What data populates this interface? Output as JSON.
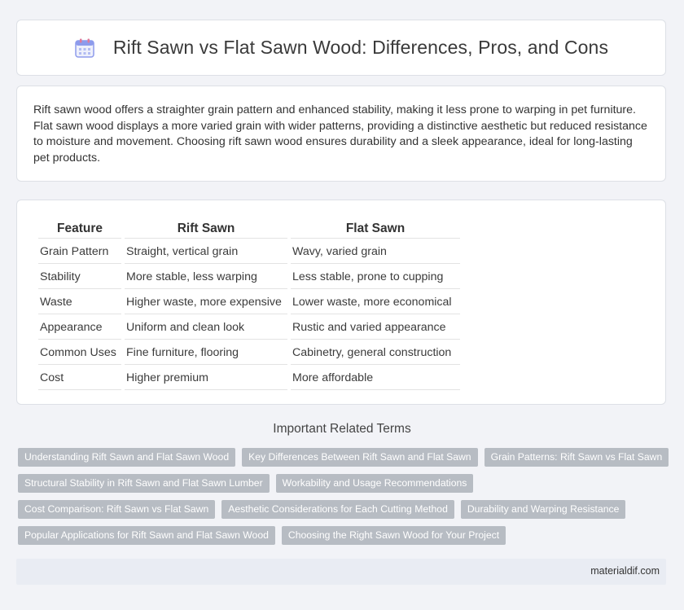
{
  "header": {
    "title": "Rift Sawn vs Flat Sawn Wood: Differences, Pros, and Cons",
    "icon": "calendar-icon"
  },
  "intro": {
    "text": "Rift sawn wood offers a straighter grain pattern and enhanced stability, making it less prone to warping in pet furniture. Flat sawn wood displays a more varied grain with wider patterns, providing a distinctive aesthetic but reduced resistance to moisture and movement. Choosing rift sawn wood ensures durability and a sleek appearance, ideal for long-lasting pet products."
  },
  "table": {
    "headers": [
      "Feature",
      "Rift Sawn",
      "Flat Sawn"
    ],
    "rows": [
      [
        "Grain Pattern",
        "Straight, vertical grain",
        "Wavy, varied grain"
      ],
      [
        "Stability",
        "More stable, less warping",
        "Less stable, prone to cupping"
      ],
      [
        "Waste",
        "Higher waste, more expensive",
        "Lower waste, more economical"
      ],
      [
        "Appearance",
        "Uniform and clean look",
        "Rustic and varied appearance"
      ],
      [
        "Common Uses",
        "Fine furniture, flooring",
        "Cabinetry, general construction"
      ],
      [
        "Cost",
        "Higher premium",
        "More affordable"
      ]
    ]
  },
  "related": {
    "title": "Important Related Terms",
    "tags": [
      "Understanding Rift Sawn and Flat Sawn Wood",
      "Key Differences Between Rift Sawn and Flat Sawn",
      "Grain Patterns: Rift Sawn vs Flat Sawn",
      "Structural Stability in Rift Sawn and Flat Sawn Lumber",
      "Workability and Usage Recommendations",
      "Cost Comparison: Rift Sawn vs Flat Sawn",
      "Aesthetic Considerations for Each Cutting Method",
      "Durability and Warping Resistance",
      "Popular Applications for Rift Sawn and Flat Sawn Wood",
      "Choosing the Right Sawn Wood for Your Project"
    ]
  },
  "footer": {
    "site": "materialdif.com"
  },
  "colors": {
    "page_bg": "#f2f3f7",
    "tag_bg": "#b7bcc3",
    "footer_bg": "#e9ecf3",
    "icon_accent": "#7b8ff0"
  }
}
